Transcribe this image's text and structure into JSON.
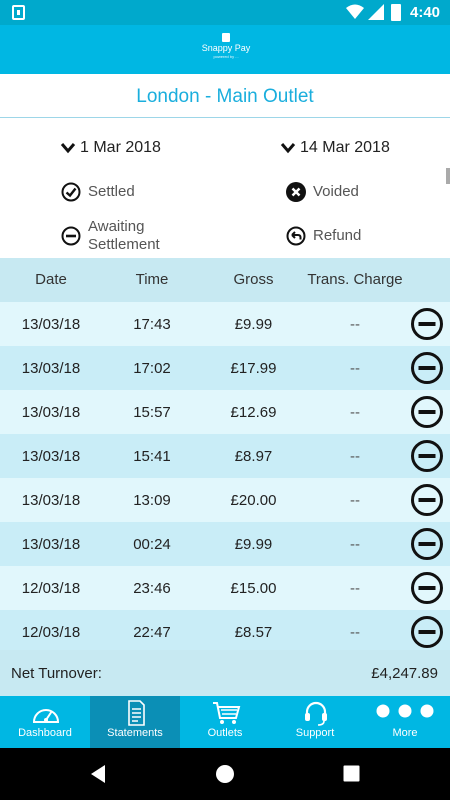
{
  "status_bar": {
    "time": "4:40"
  },
  "app": {
    "logo_name": "Snappy Pay",
    "logo_tag": "powered by ..."
  },
  "outlet": {
    "title": "London - Main Outlet"
  },
  "filters": {
    "from_date": "1 Mar 2018",
    "to_date": "14 Mar 2018"
  },
  "legend": {
    "settled": "Settled",
    "voided": "Voided",
    "awaiting_line1": "Awaiting",
    "awaiting_line2": "Settlement",
    "refund": "Refund"
  },
  "table": {
    "headers": {
      "date": "Date",
      "time": "Time",
      "gross": "Gross",
      "charge": "Trans. Charge"
    },
    "rows": [
      {
        "date": "13/03/18",
        "time": "17:43",
        "gross": "£9.99",
        "charge": "--",
        "status": "awaiting-settlement-icon"
      },
      {
        "date": "13/03/18",
        "time": "17:02",
        "gross": "£17.99",
        "charge": "--",
        "status": "awaiting-settlement-icon"
      },
      {
        "date": "13/03/18",
        "time": "15:57",
        "gross": "£12.69",
        "charge": "--",
        "status": "awaiting-settlement-icon"
      },
      {
        "date": "13/03/18",
        "time": "15:41",
        "gross": "£8.97",
        "charge": "--",
        "status": "awaiting-settlement-icon"
      },
      {
        "date": "13/03/18",
        "time": "13:09",
        "gross": "£20.00",
        "charge": "--",
        "status": "awaiting-settlement-icon"
      },
      {
        "date": "13/03/18",
        "time": "00:24",
        "gross": "£9.99",
        "charge": "--",
        "status": "awaiting-settlement-icon"
      },
      {
        "date": "12/03/18",
        "time": "23:46",
        "gross": "£15.00",
        "charge": "--",
        "status": "awaiting-settlement-icon"
      },
      {
        "date": "12/03/18",
        "time": "22:47",
        "gross": "£8.57",
        "charge": "--",
        "status": "awaiting-settlement-icon"
      }
    ]
  },
  "summary": {
    "net_label": "Net Turnover:",
    "net_value": "£4,247.89"
  },
  "nav": {
    "items": [
      {
        "label": "Dashboard",
        "icon": "speedometer-icon"
      },
      {
        "label": "Statements",
        "icon": "document-icon",
        "active": true
      },
      {
        "label": "Outlets",
        "icon": "cart-icon"
      },
      {
        "label": "Support",
        "icon": "headset-icon"
      },
      {
        "label": "More",
        "icon": "more-dots-icon"
      }
    ]
  },
  "colors": {
    "primary": "#00b7e3",
    "accent_text": "#1aaedd",
    "row_light": "#e1f7fc",
    "row_dark": "#c9edf7"
  }
}
